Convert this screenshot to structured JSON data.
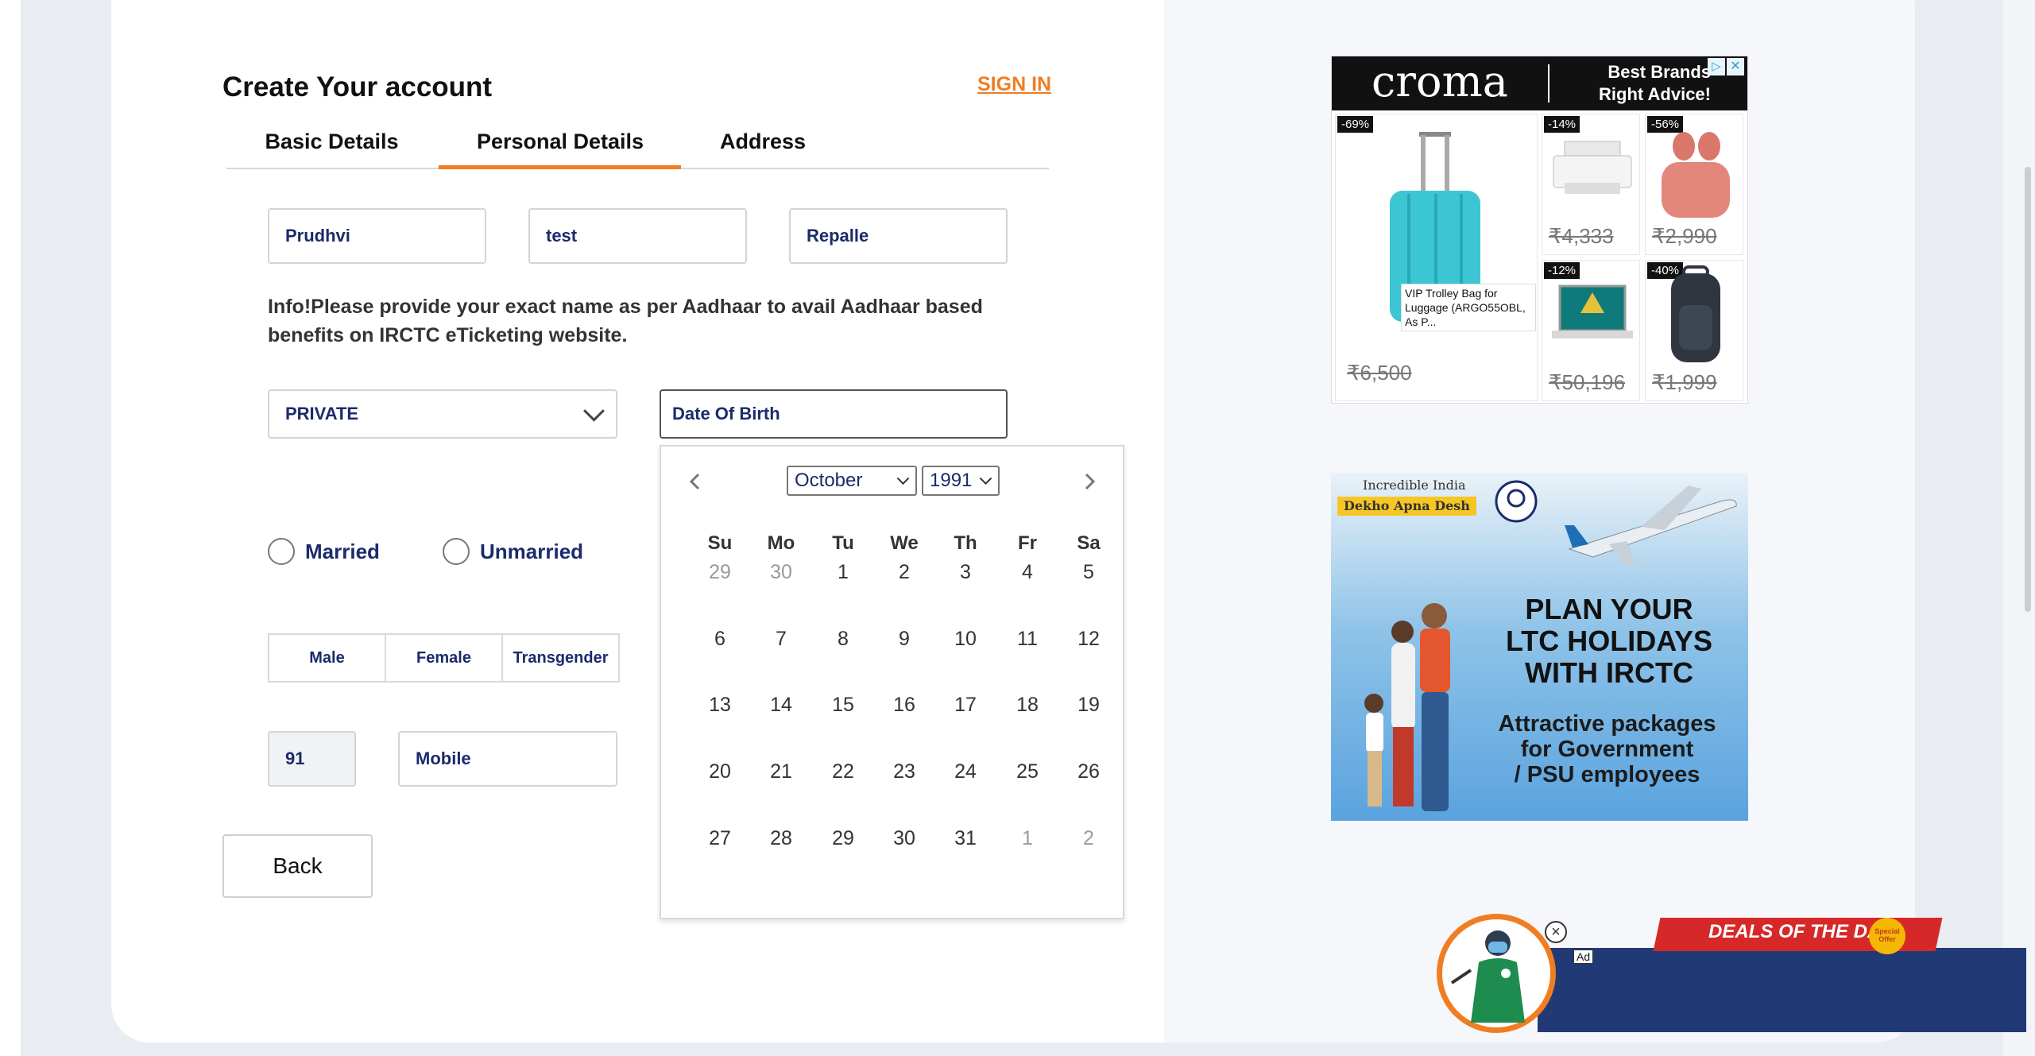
{
  "form": {
    "title": "Create Your account",
    "sign_in": "SIGN IN",
    "tabs": [
      {
        "label": "Basic Details"
      },
      {
        "label": "Personal Details",
        "active": true
      },
      {
        "label": "Address"
      }
    ],
    "first_name": "Prudhvi",
    "middle_name": "test",
    "last_name": "Repalle",
    "info": "Info!Please provide your exact name as per Aadhaar to avail Aadhaar based benefits on IRCTC eTicketing website.",
    "occupation": "PRIVATE",
    "dob_placeholder": "Date Of Birth",
    "marital": [
      "Married",
      "Unmarried"
    ],
    "gender": [
      "Male",
      "Female",
      "Transgender"
    ],
    "country_code": "91",
    "mobile_placeholder": "Mobile",
    "back": "Back"
  },
  "calendar": {
    "month": "October",
    "year": "1991",
    "weekdays": [
      "Su",
      "Mo",
      "Tu",
      "We",
      "Th",
      "Fr",
      "Sa"
    ],
    "weeks": [
      [
        "29",
        "30",
        "1",
        "2",
        "3",
        "4",
        "5"
      ],
      [
        "6",
        "7",
        "8",
        "9",
        "10",
        "11",
        "12"
      ],
      [
        "13",
        "14",
        "15",
        "16",
        "17",
        "18",
        "19"
      ],
      [
        "20",
        "21",
        "22",
        "23",
        "24",
        "25",
        "26"
      ],
      [
        "27",
        "28",
        "29",
        "30",
        "31",
        "1",
        "2"
      ]
    ],
    "muted": [
      [
        0,
        0
      ],
      [
        0,
        1
      ],
      [
        4,
        5
      ],
      [
        4,
        6
      ]
    ]
  },
  "croma_ad": {
    "logo": "croma",
    "tag_line1": "Best Brands",
    "tag_line2": "Right Advice!",
    "products": [
      {
        "discount": "-69%",
        "price": "₹6,500",
        "caption": "VIP Trolley Bag for Luggage (ARGO55OBL, As P..."
      },
      {
        "discount": "-14%",
        "price": "₹4,333"
      },
      {
        "discount": "-56%",
        "price": "₹2,990"
      },
      {
        "discount": "-12%",
        "price": "₹50,196"
      },
      {
        "discount": "-40%",
        "price": "₹1,999"
      }
    ]
  },
  "ltc_ad": {
    "brand1": "Incredible India",
    "brand2": "Dekho Apna Desh",
    "heading": [
      "PLAN YOUR",
      "LTC HOLIDAYS",
      "WITH IRCTC"
    ],
    "sub": [
      "Attractive packages",
      "for Government",
      "/ PSU employees"
    ]
  },
  "deals": {
    "text": "DEALS OF THE DAY",
    "badge": "Special Offer",
    "ad": "Ad"
  },
  "colors": {
    "accent": "#f07d22",
    "navy": "#1b2b6b",
    "deals_bar": "#213a75"
  }
}
